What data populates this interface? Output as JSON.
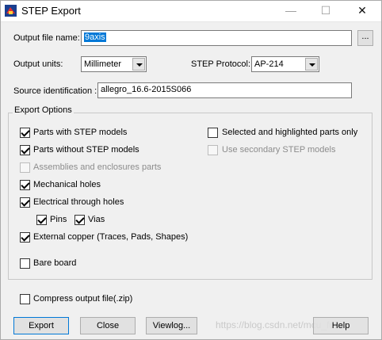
{
  "window": {
    "title": "STEP Export",
    "minimize_glyph": "—",
    "maximize_glyph": "☐",
    "close_glyph": "✕"
  },
  "output_file": {
    "label": "Output file name:",
    "value": "9axis",
    "browse_label": "..."
  },
  "units": {
    "label": "Output units:",
    "value": "Millimeter"
  },
  "protocol": {
    "label": "STEP Protocol:",
    "value": "AP-214"
  },
  "source": {
    "label": "Source identification :",
    "value": "allegro_16.6-2015S066"
  },
  "export_options": {
    "title": "Export Options",
    "parts_with_step": {
      "label": "Parts with STEP models",
      "checked": true,
      "enabled": true
    },
    "parts_without_step": {
      "label": "Parts without STEP models",
      "checked": true,
      "enabled": true
    },
    "assemblies": {
      "label": "Assemblies and enclosures parts",
      "checked": false,
      "enabled": false
    },
    "mechanical_holes": {
      "label": "Mechanical holes",
      "checked": true,
      "enabled": true
    },
    "electrical_holes": {
      "label": "Electrical through holes",
      "checked": true,
      "enabled": true
    },
    "pins": {
      "label": "Pins",
      "checked": true,
      "enabled": true
    },
    "vias": {
      "label": "Vias",
      "checked": true,
      "enabled": true
    },
    "external_copper": {
      "label": "External copper (Traces, Pads, Shapes)",
      "checked": true,
      "enabled": true
    },
    "bare_board": {
      "label": "Bare board",
      "checked": false,
      "enabled": true
    },
    "selected_highlighted": {
      "label": "Selected and highlighted parts only",
      "checked": false,
      "enabled": true
    },
    "secondary_models": {
      "label": "Use secondary STEP models",
      "checked": false,
      "enabled": false
    }
  },
  "compress": {
    "label": "Compress output file(.zip)",
    "checked": false
  },
  "buttons": {
    "export": "Export",
    "close": "Close",
    "viewlog": "Viewlog...",
    "help": "Help"
  },
  "watermark": "https://blog.csdn.net/mcu_fuzi",
  "colors": {
    "selection": "#0078d7",
    "disabled_text": "#8c8c8c",
    "background": "#f0f0f0"
  }
}
